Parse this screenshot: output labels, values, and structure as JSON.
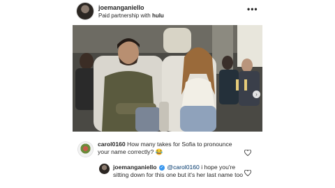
{
  "post": {
    "username": "joemanganiello",
    "partnership_prefix": "Paid partnership with ",
    "partner": "hulu",
    "more_label": "•••"
  },
  "media": {
    "description": "Two people seated in airplane cabin seats",
    "next_glyph": "›"
  },
  "comments": [
    {
      "username": "carol0160",
      "text": " How many takes for Sofia to pronounce your name correctly? 😂"
    },
    {
      "username": "joemanganiello",
      "mention": "@carol0160",
      "text": " i hope you're sitting down for this one but it's her last name too"
    }
  ],
  "icons": {
    "more": "more-options-icon",
    "like": "heart-icon",
    "verified": "verified-badge-icon",
    "next": "chevron-right-icon"
  },
  "colors": {
    "text": "#262626",
    "verified": "#3897f0",
    "mention": "#00376b"
  }
}
